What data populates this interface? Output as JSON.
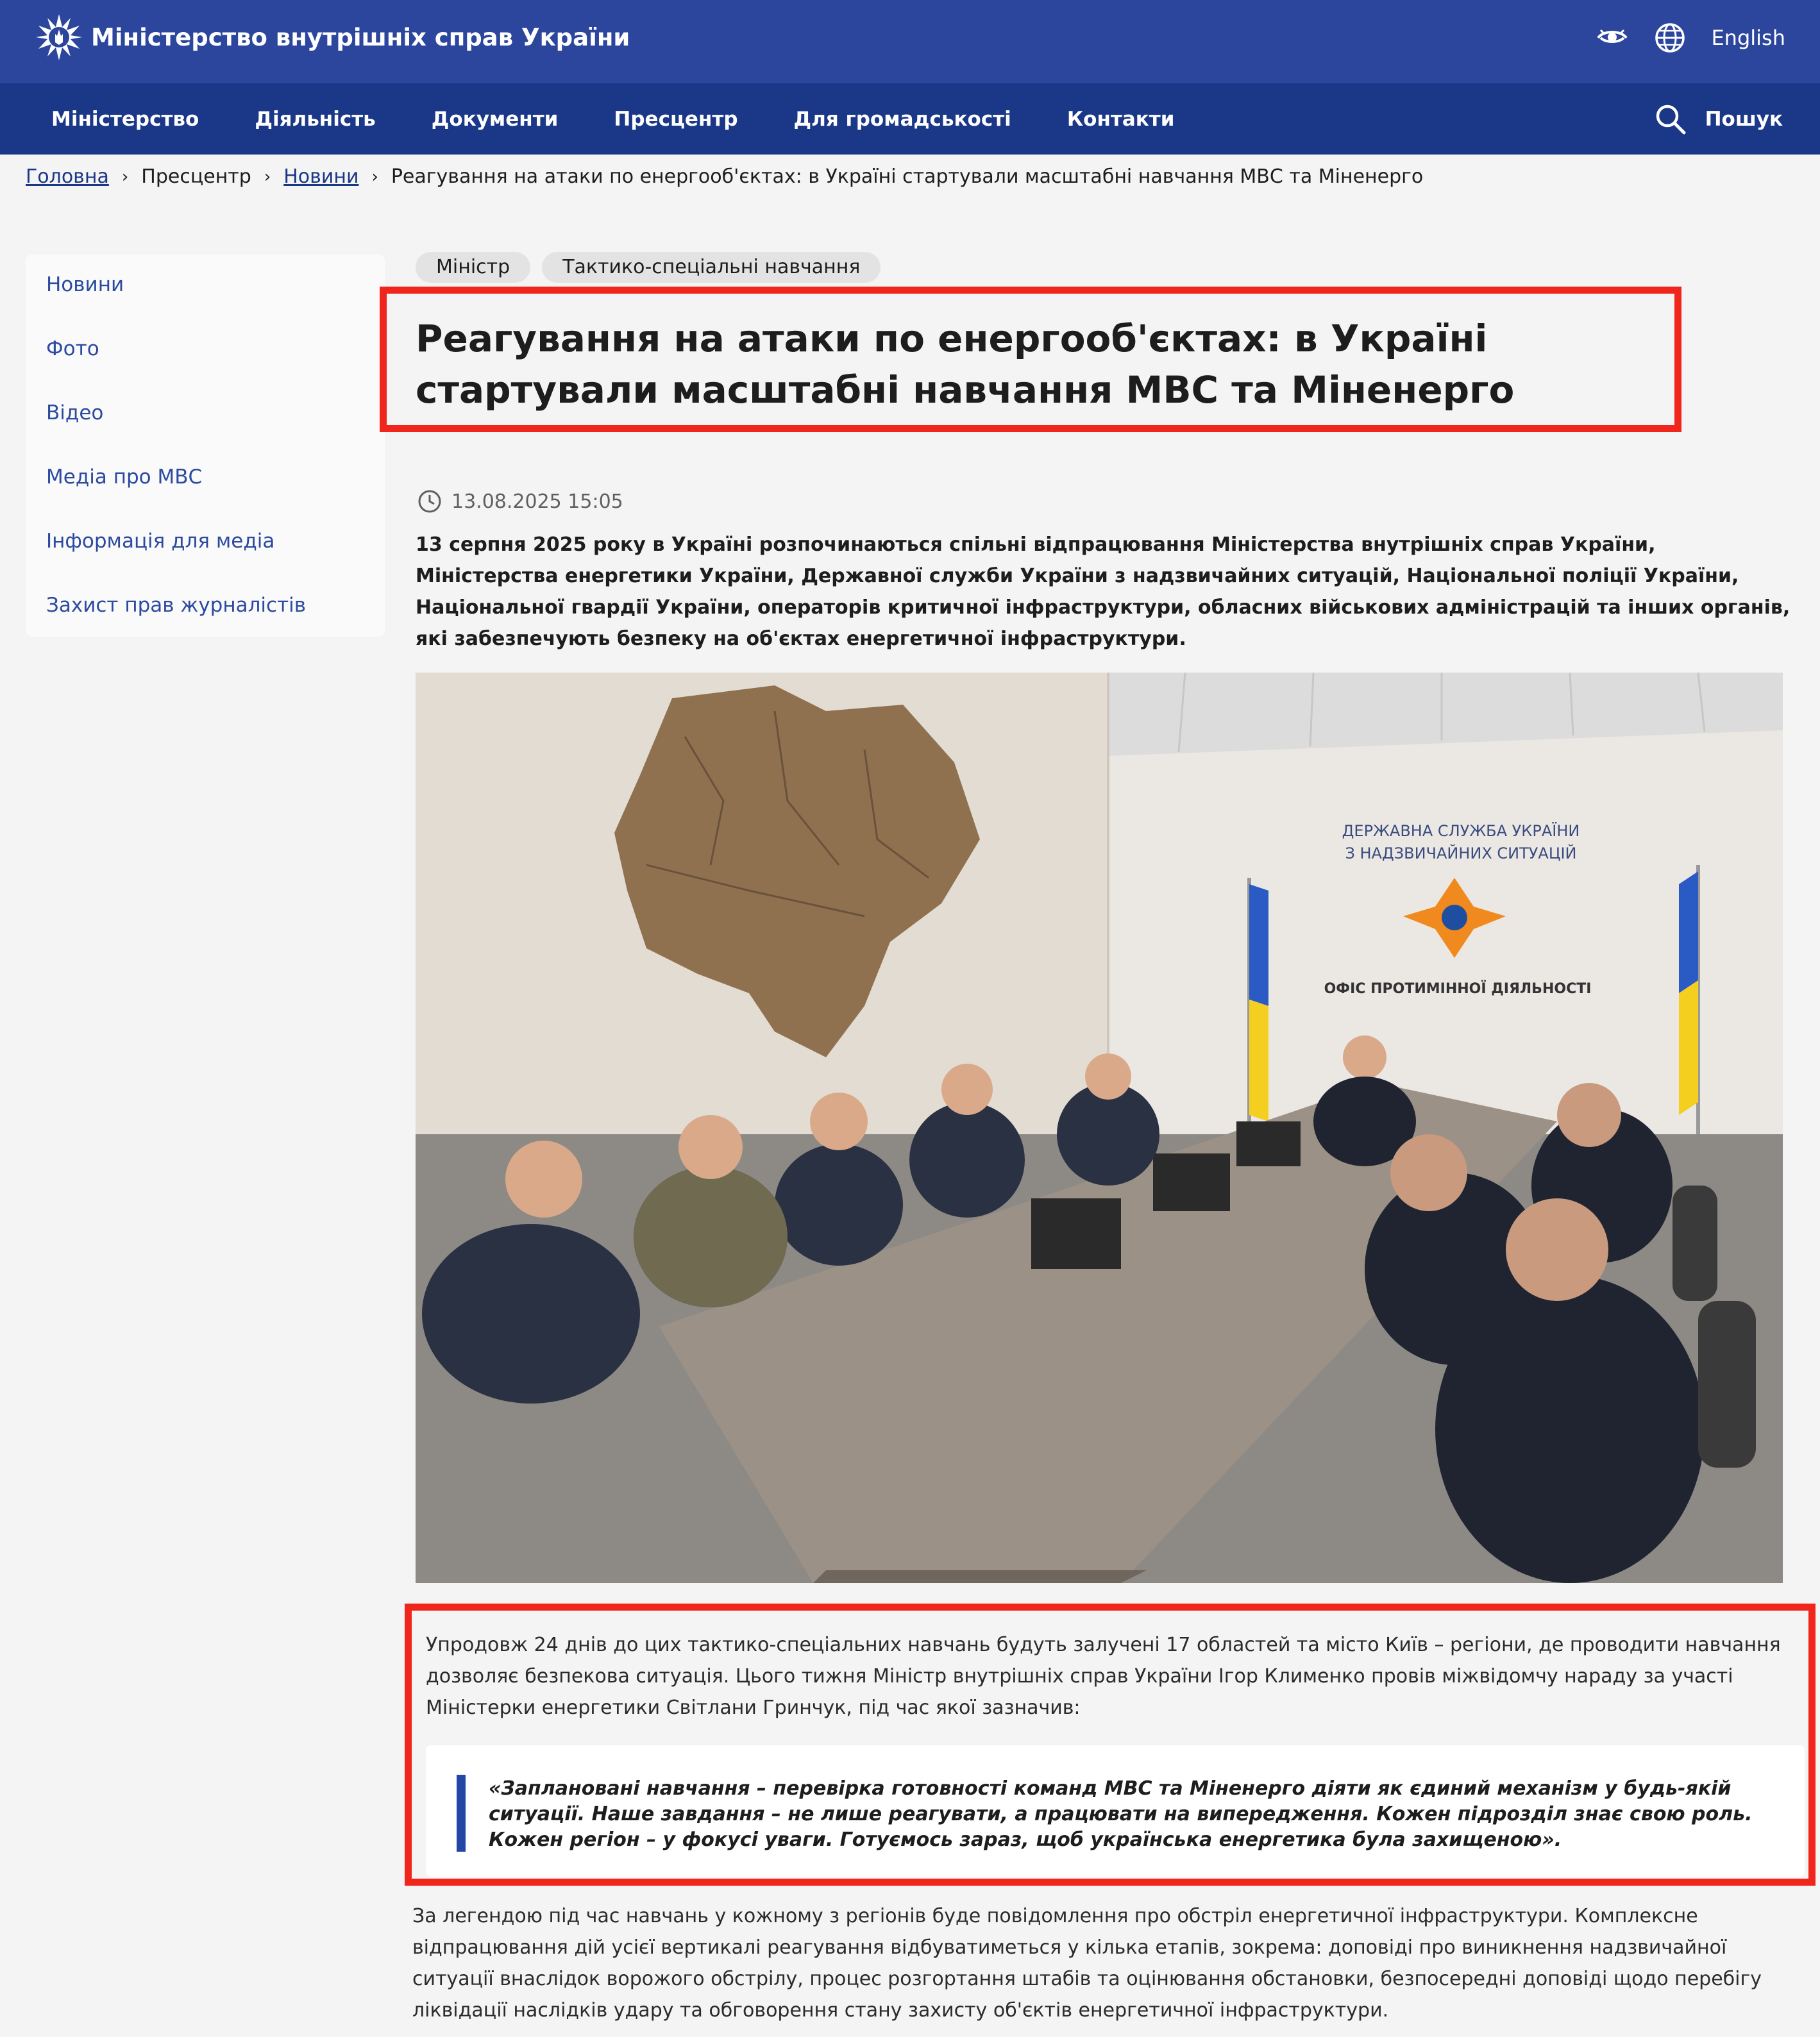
{
  "header": {
    "site_name": "Міністерство внутрішніх справ України",
    "language_label": "English"
  },
  "nav": {
    "items": [
      "Міністерство",
      "Діяльність",
      "Документи",
      "Пресцентр",
      "Для громадськості",
      "Контакти"
    ],
    "search_label": "Пошук"
  },
  "breadcrumb": {
    "home": "Головна",
    "section": "Пресцентр",
    "news": "Новини",
    "current": "Реагування на атаки по енергооб'єктах: в Україні стартували масштабні навчання МВС та Міненерго"
  },
  "sidebar": {
    "items": [
      "Новини",
      "Фото",
      "Відео",
      "Медіа про МВС",
      "Інформація для медіа",
      "Захист прав журналістів"
    ]
  },
  "article": {
    "tags": [
      "Міністр",
      "Тактико-спеціальні навчання"
    ],
    "title": "Реагування на атаки по енергооб'єктах: в Україні стартували масштабні навчання МВС та Міненерго",
    "datetime": "13.08.2025 15:05",
    "lead": "13 серпня 2025 року в Україні розпочинаються спільні відпрацювання Міністерства внутрішніх справ України, Міністерства енергетики України, Державної служби України з надзвичайних ситуацій, Національної поліції України, Національної гвардії України, операторів критичної інфраструктури, обласних військових адміністрацій та інших органів, які забезпечують безпеку на об'єктах енергетичної інфраструктури.",
    "photo": {
      "sign_line1": "ДЕРЖАВНА СЛУЖБА УКРАЇНИ",
      "sign_line2": "З НАДЗВИЧАЙНИХ СИТУАЦІЙ",
      "sign_office": "ОФІС ПРОТИМІННОЇ ДІЯЛЬНОСТІ"
    },
    "paragraph1": "Упродовж 24 днів до цих тактико-спеціальних навчань будуть залучені 17 областей та місто Київ – регіони, де проводити навчання дозволяє безпекова ситуація. Цього тижня Міністр внутрішніх справ України Ігор Клименко провів міжвідомчу нараду за участі Міністерки енергетики Світлани Гринчук, під час якої зазначив:",
    "quote": "«Заплановані навчання – перевірка готовності команд МВС та Міненерго діяти як єдиний механізм у будь-якій ситуації. Наше завдання – не лише реагувати, а працювати на випередження. Кожен підрозділ знає свою роль. Кожен регіон – у фокусі уваги. Готуємось зараз, щоб українська енергетика була захищеною».",
    "paragraph2": "За легендою під час навчань у кожному з регіонів буде повідомлення про обстріл енергетичної інфраструктури. Комплексне відпрацювання дій усієї вертикалі реагування відбуватиметься у кілька етапів, зокрема: доповіді про виникнення надзвичайної ситуації внаслідок ворожого обстрілу, процес розгортання штабів та оцінювання обстановки, безпосередні доповіді щодо перебігу ліквідації наслідків удару та обговорення стану захисту об'єктів енергетичної інфраструктури."
  },
  "colors": {
    "topbar": "#2c469e",
    "navbar": "#1b3787",
    "link": "#2b4aa0",
    "highlight": "#f0261c",
    "quote_accent": "#2447a6"
  }
}
